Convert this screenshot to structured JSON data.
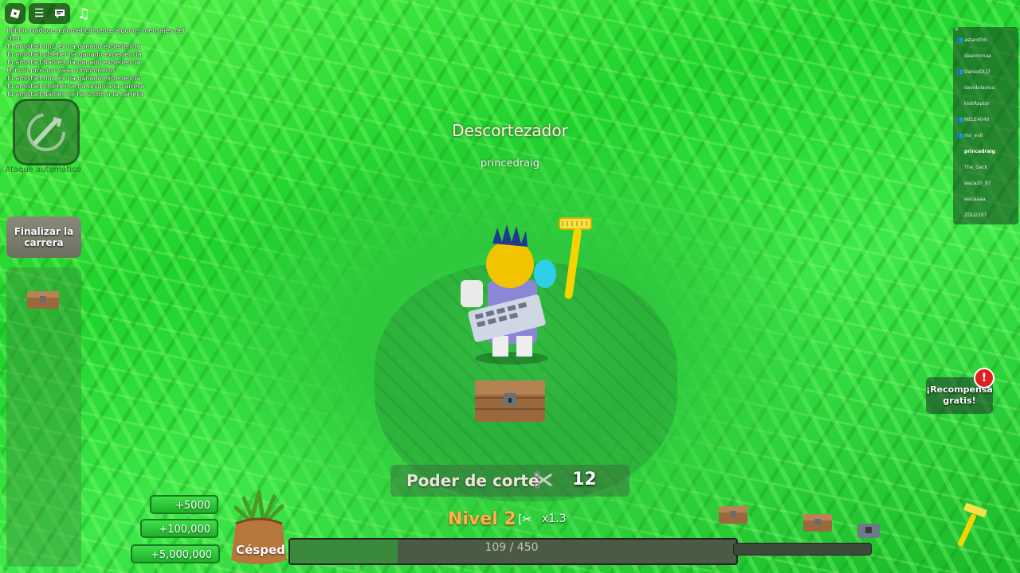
{
  "topbar": {
    "roblox_icon": "roblox-logo-icon",
    "menu_icon": "menu-icon",
    "chat_icon": "chat-icon",
    "music_icon": "music-icon"
  },
  "chat": {
    "lines": [
      "Roblox traduce automáticamente algunos mensajes del",
      "chat",
      "Tu amistad rinz_ex ha ganado experiencia",
      "Tu amistad ptsehei ha ganado experiencia",
      "Tu amistad Nabie3 ha ganado experiencia",
      "Primoi: prosoco yaaa jumotorierro",
      "Tu amistad rinz_ex ha ganado experiencia",
      "Tu amistad ptsehei se ha unido a la carrera",
      "Tu amistad Nabie3 se ha unido a la carrera"
    ]
  },
  "auto_attack": {
    "label": "Ataque automático"
  },
  "finish_race": {
    "label": "Finalizar la carrera"
  },
  "world": {
    "tool_name": "Descortezador",
    "player_name": "princedraig"
  },
  "player_list": {
    "players": [
      {
        "name": "astarothh",
        "friend": true
      },
      {
        "name": "daannnnaa",
        "friend": false
      },
      {
        "name": "DanielDLJ7",
        "friend": true
      },
      {
        "name": "davidulaviuu",
        "friend": false
      },
      {
        "name": "kiskRaptor",
        "friend": false
      },
      {
        "name": "MELE4040",
        "friend": true
      },
      {
        "name": "mx_evil",
        "friend": true
      },
      {
        "name": "princedraig",
        "friend": false,
        "me": true
      },
      {
        "name": "The_Dack",
        "friend": false
      },
      {
        "name": "waza20_97",
        "friend": false
      },
      {
        "name": "wazaaaa",
        "friend": false
      },
      {
        "name": "ZDU2207",
        "friend": false
      }
    ]
  },
  "reward": {
    "label": "¡Recompensa gratis!",
    "alert": "!"
  },
  "hud": {
    "power_label": "Poder de corte",
    "power_value": "12",
    "level_label": "Nivel 2",
    "multiplier": "x1.3",
    "progress_text": "109 / 450",
    "progress_fraction": 0.242,
    "money_buttons": [
      "+5000",
      "+100,000",
      "+5,000,000"
    ],
    "sack_label": "Césped"
  },
  "colors": {
    "grass": "#2ec73c",
    "level": "#ffb14a",
    "money_button": "#2fcf3a"
  }
}
